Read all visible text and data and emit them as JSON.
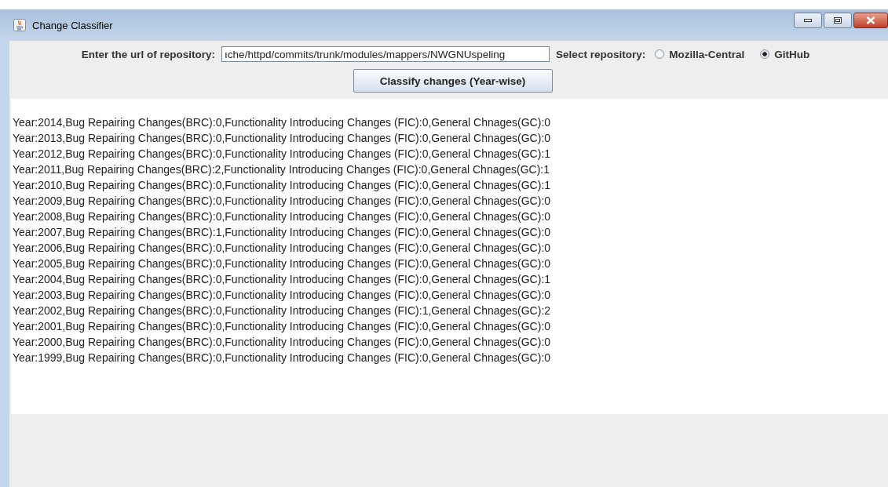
{
  "window": {
    "title": "Change Classifier"
  },
  "url_field": {
    "label": "Enter the url of repository:",
    "value": "ıche/httpd/commits/trunk/modules/mappers/NWGNUspeling"
  },
  "repository": {
    "label": "Select repository:",
    "options": [
      {
        "label": "Mozilla-Central",
        "selected": false
      },
      {
        "label": "GitHub",
        "selected": true
      }
    ]
  },
  "classify_button": {
    "label": "Classify changes (Year-wise)"
  },
  "results": [
    "Year:2014,Bug Repairing Changes(BRC):0,Functionality Introducing Changes (FIC):0,General Chnages(GC):0",
    "Year:2013,Bug Repairing Changes(BRC):0,Functionality Introducing Changes (FIC):0,General Chnages(GC):0",
    "Year:2012,Bug Repairing Changes(BRC):0,Functionality Introducing Changes (FIC):0,General Chnages(GC):1",
    "Year:2011,Bug Repairing Changes(BRC):2,Functionality Introducing Changes (FIC):0,General Chnages(GC):1",
    "Year:2010,Bug Repairing Changes(BRC):0,Functionality Introducing Changes (FIC):0,General Chnages(GC):1",
    "Year:2009,Bug Repairing Changes(BRC):0,Functionality Introducing Changes (FIC):0,General Chnages(GC):0",
    "Year:2008,Bug Repairing Changes(BRC):0,Functionality Introducing Changes (FIC):0,General Chnages(GC):0",
    "Year:2007,Bug Repairing Changes(BRC):1,Functionality Introducing Changes (FIC):0,General Chnages(GC):0",
    "Year:2006,Bug Repairing Changes(BRC):0,Functionality Introducing Changes (FIC):0,General Chnages(GC):0",
    "Year:2005,Bug Repairing Changes(BRC):0,Functionality Introducing Changes (FIC):0,General Chnages(GC):0",
    "Year:2004,Bug Repairing Changes(BRC):0,Functionality Introducing Changes (FIC):0,General Chnages(GC):1",
    "Year:2003,Bug Repairing Changes(BRC):0,Functionality Introducing Changes (FIC):0,General Chnages(GC):0",
    "Year:2002,Bug Repairing Changes(BRC):0,Functionality Introducing Changes (FIC):1,General Chnages(GC):2",
    "Year:2001,Bug Repairing Changes(BRC):0,Functionality Introducing Changes (FIC):0,General Chnages(GC):0",
    "Year:2000,Bug Repairing Changes(BRC):0,Functionality Introducing Changes (FIC):0,General Chnages(GC):0",
    "Year:1999,Bug Repairing Changes(BRC):0,Functionality Introducing Changes (FIC):0,General Chnages(GC):0"
  ]
}
